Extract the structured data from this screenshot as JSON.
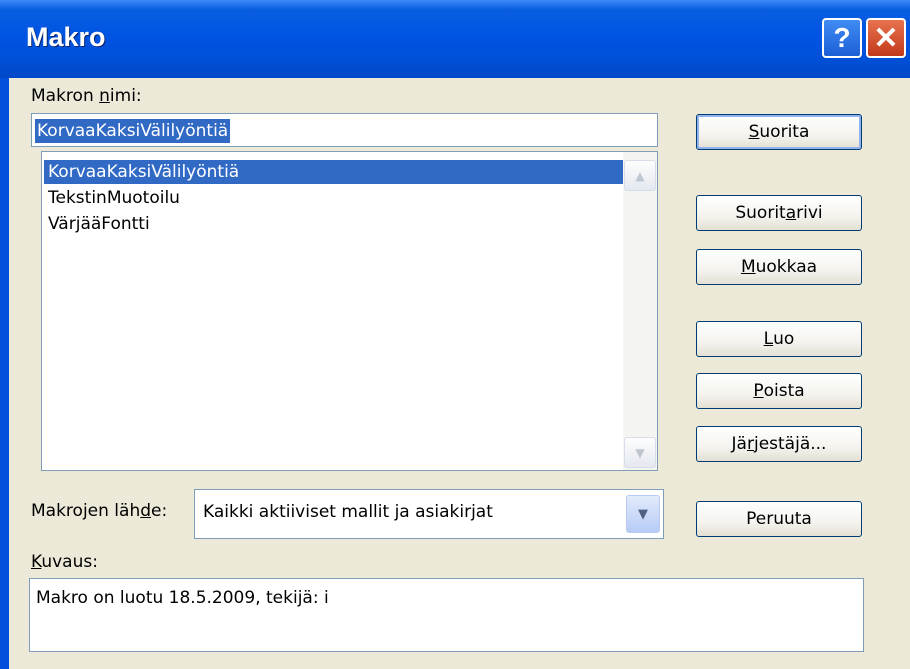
{
  "window": {
    "title": "Makro"
  },
  "title_buttons": {
    "help": "?",
    "close": "✕"
  },
  "macro_name": {
    "label_pre": "Makron ",
    "label_key": "n",
    "label_post": "imi:",
    "value": "KorvaaKaksiVälilyöntiä"
  },
  "macro_list": {
    "items": [
      "KorvaaKaksiVälilyöntiä",
      "TekstinMuotoilu",
      "VärjääFontti"
    ],
    "selected_index": 0
  },
  "buttons": [
    {
      "pre": "",
      "key": "S",
      "post": "uorita",
      "default": true
    },
    {
      "pre": "Suorit",
      "key": "a",
      "post": " rivi"
    },
    {
      "pre": "",
      "key": "M",
      "post": "uokkaa"
    },
    {
      "pre": "",
      "key": "L",
      "post": "uo"
    },
    {
      "pre": "",
      "key": "P",
      "post": "oista"
    },
    {
      "pre": "Jä",
      "key": "r",
      "post": "jestäjä..."
    },
    {
      "pre": "Peruuta",
      "key": "",
      "post": ""
    }
  ],
  "macro_source": {
    "label_pre": "Makrojen läh",
    "label_key": "d",
    "label_post": "e:",
    "value": "Kaikki aktiiviset mallit ja asiakirjat"
  },
  "description": {
    "label_pre": "",
    "label_key": "K",
    "label_post": "uvaus:",
    "value": "Makro on luotu 18.5.2009, tekijä: i"
  },
  "icons": {
    "scroll_up": "chevron-up-icon",
    "scroll_down": "chevron-down-icon",
    "dropdown": "chevron-down-icon"
  }
}
